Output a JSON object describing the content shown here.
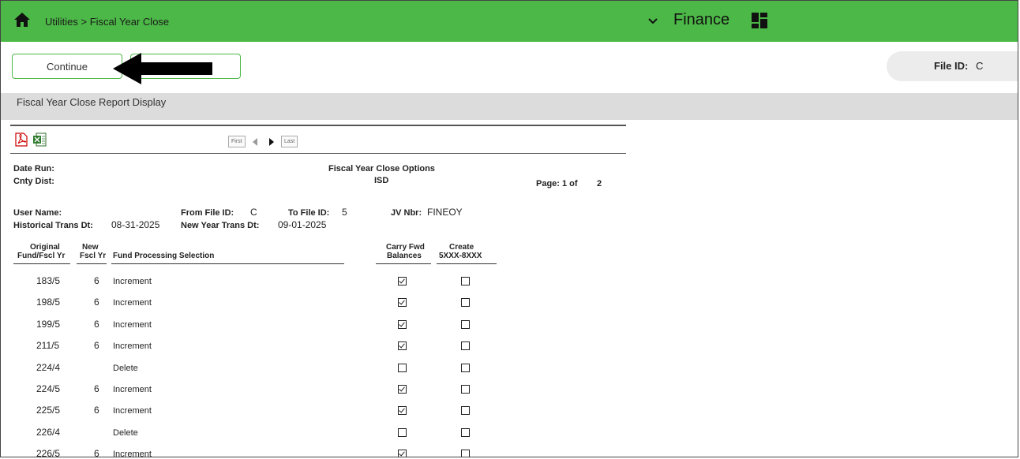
{
  "header": {
    "breadcrumb": "Utilities > Fiscal Year Close",
    "module": "Finance",
    "icons": {
      "home": "home-icon",
      "dropdown": "chevron-down-icon",
      "apps": "grid-icon"
    },
    "color": "#4cb847"
  },
  "toolbar": {
    "continue_label": "Continue"
  },
  "file_id": {
    "label": "File ID:",
    "value": "C"
  },
  "section_title": "Fiscal Year Close Report Display",
  "report": {
    "pager": {
      "first": "First",
      "last": "Last"
    },
    "date_run_label": "Date Run:",
    "cnty_dist_label": "Cnty Dist:",
    "title": "Fiscal Year Close Options",
    "subtitle": "ISD",
    "page_label": "Page: 1 of",
    "page_total": "2",
    "user_name_label": "User Name:",
    "historical_label": "Historical Trans Dt:",
    "historical_value": "08-31-2025",
    "from_file_label": "From File ID:",
    "from_file_value": "C",
    "new_year_label": "New Year Trans Dt:",
    "new_year_value": "09-01-2025",
    "to_file_label": "To File ID:",
    "to_file_value": "5",
    "jv_label": "JV Nbr:",
    "jv_value": "FINEOY",
    "columns": {
      "orig_1": "Original",
      "orig_2": "Fund/Fscl Yr",
      "new_1": "New",
      "new_2": "Fscl Yr",
      "selection": "Fund Processing Selection",
      "carry_1": "Carry Fwd",
      "carry_2": "Balances",
      "create_1": "Create",
      "create_2": "5XXX-8XXX"
    },
    "rows": [
      {
        "fund": "183/5",
        "fy": "6",
        "selection": "Increment",
        "carry": true,
        "create": false
      },
      {
        "fund": "198/5",
        "fy": "6",
        "selection": "Increment",
        "carry": true,
        "create": false
      },
      {
        "fund": "199/5",
        "fy": "6",
        "selection": "Increment",
        "carry": true,
        "create": false
      },
      {
        "fund": "211/5",
        "fy": "6",
        "selection": "Increment",
        "carry": true,
        "create": false
      },
      {
        "fund": "224/4",
        "fy": "",
        "selection": "Delete",
        "carry": false,
        "create": false
      },
      {
        "fund": "224/5",
        "fy": "6",
        "selection": "Increment",
        "carry": true,
        "create": false
      },
      {
        "fund": "225/5",
        "fy": "6",
        "selection": "Increment",
        "carry": true,
        "create": false
      },
      {
        "fund": "226/4",
        "fy": "",
        "selection": "Delete",
        "carry": false,
        "create": false
      },
      {
        "fund": "226/5",
        "fy": "6",
        "selection": "Increment",
        "carry": true,
        "create": false
      }
    ]
  }
}
